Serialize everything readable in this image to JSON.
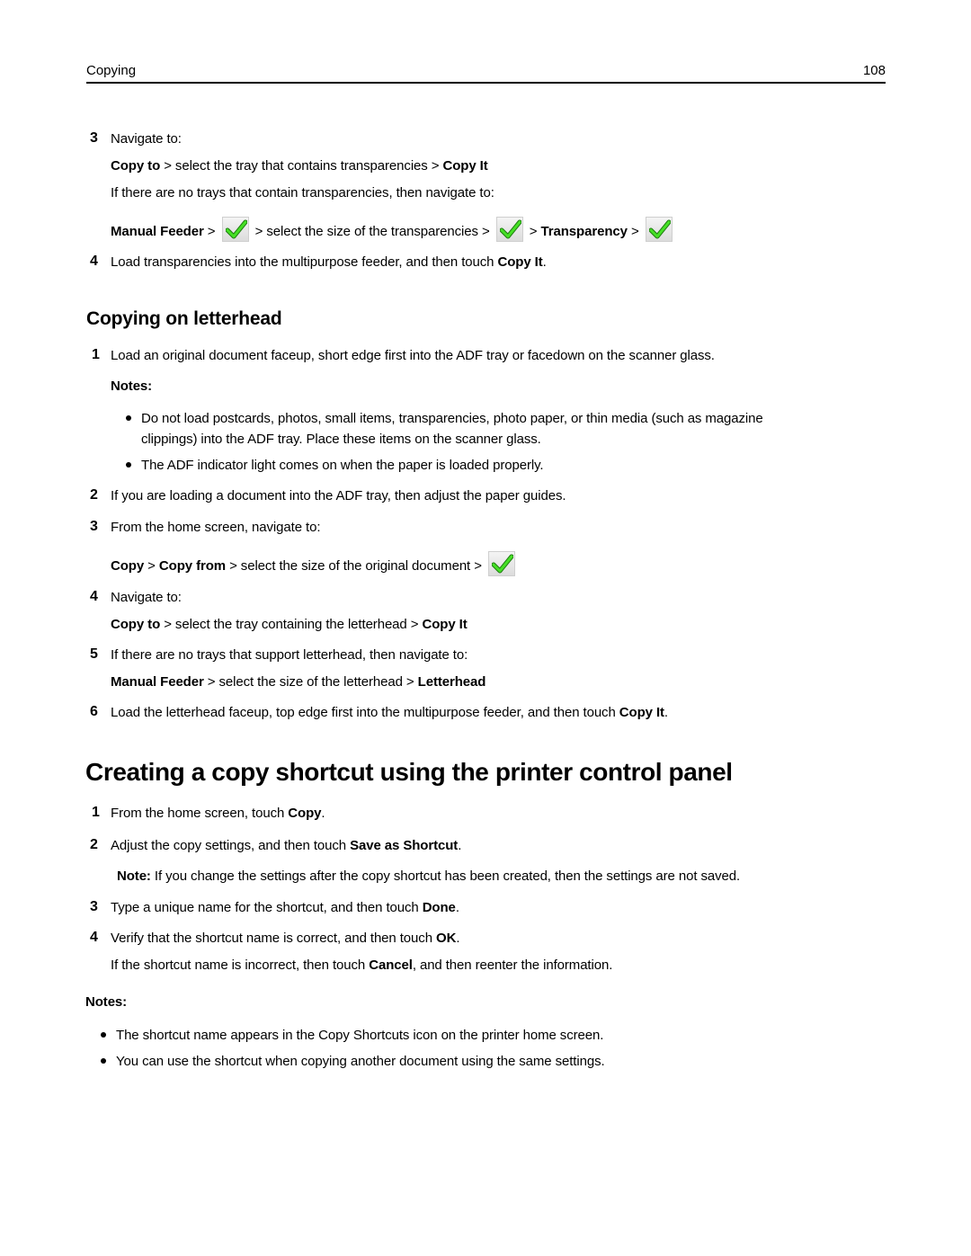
{
  "header": {
    "section": "Copying",
    "page_number": "108"
  },
  "top_steps": {
    "step3": {
      "num": "3",
      "text": "Navigate to:",
      "path1": {
        "a": "Copy to",
        "b": " > select the tray that contains transparencies > ",
        "c": "Copy It"
      },
      "alt": "If there are no trays that contain transparencies, then navigate to:",
      "path2": {
        "a": "Manual Feeder",
        "b": " > ",
        "c": " > select the size of the transparencies > ",
        "d": " > ",
        "e": "Transparency",
        "f": " > "
      }
    },
    "step4": {
      "num": "4",
      "a": "Load transparencies into the multipurpose feeder, and then touch ",
      "b": "Copy It",
      "c": "."
    }
  },
  "letterhead": {
    "title": "Copying on letterhead",
    "step1": {
      "num": "1",
      "text": "Load an original document faceup, short edge first into the ADF tray or facedown on the scanner glass."
    },
    "notes_label": "Notes:",
    "notes": [
      {
        "line1": "Do not load postcards, photos, small items, transparencies, photo paper, or thin media (such as magazine",
        "line2": "clippings) into the ADF tray. Place these items on the scanner glass."
      },
      {
        "line1": "The ADF indicator light comes on when the paper is loaded properly."
      }
    ],
    "step2": {
      "num": "2",
      "text": "If you are loading a document into the ADF tray, then adjust the paper guides."
    },
    "step3": {
      "num": "3",
      "text": "From the home screen, navigate to:",
      "path": {
        "a": "Copy",
        "b": " > ",
        "c": "Copy from",
        "d": " > select the size of the original document > "
      }
    },
    "step4": {
      "num": "4",
      "text": "Navigate to:",
      "path": {
        "a": "Copy to",
        "b": " > select the tray containing the letterhead > ",
        "c": "Copy It"
      }
    },
    "step5": {
      "num": "5",
      "text": "If there are no trays that support letterhead, then navigate to:",
      "path": {
        "a": "Manual Feeder",
        "b": " > select the size of the letterhead > ",
        "c": "Letterhead"
      }
    },
    "step6": {
      "num": "6",
      "a": "Load the letterhead faceup, top edge first into the multipurpose feeder, and then touch ",
      "b": "Copy It",
      "c": "."
    }
  },
  "shortcut": {
    "title": "Creating a copy shortcut using the printer control panel",
    "step1": {
      "num": "1",
      "a": "From the home screen, touch ",
      "b": "Copy",
      "c": "."
    },
    "step2": {
      "num": "2",
      "a": "Adjust the copy settings, and then touch ",
      "b": "Save as Shortcut",
      "c": "."
    },
    "note": {
      "label": "Note:",
      "text": " If you change the settings after the copy shortcut has been created, then the settings are not saved."
    },
    "step3": {
      "num": "3",
      "a": "Type a unique name for the shortcut, and then touch ",
      "b": "Done",
      "c": "."
    },
    "step4": {
      "num": "4",
      "a": "Verify that the shortcut name is correct, and then touch ",
      "b": "OK",
      "c": "."
    },
    "step4_extra": {
      "a": "If the shortcut name is incorrect, then touch ",
      "b": "Cancel",
      "c": ", and then reenter the information."
    },
    "notes_label": "Notes:",
    "notes": [
      "The shortcut name appears in the Copy Shortcuts icon on the printer home screen.",
      "You can use the shortcut when copying another document using the same settings."
    ]
  },
  "icons": {
    "check": "check-mark-icon",
    "check_color": "#39d11f"
  }
}
